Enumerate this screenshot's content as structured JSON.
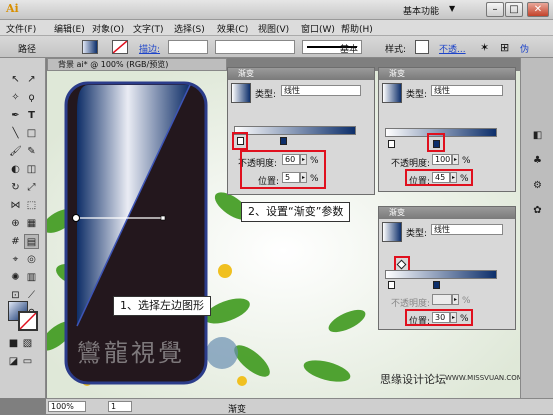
{
  "app": {
    "logo_text": "Ai",
    "workspace": "基本功能",
    "win_min": "–",
    "win_max": "□",
    "win_close": "✕"
  },
  "menu": [
    "文件(F)",
    "编辑(E)",
    "对象(O)",
    "文字(T)",
    "选择(S)",
    "效果(C)",
    "视图(V)",
    "窗口(W)",
    "帮助(H)"
  ],
  "control": {
    "mode_label": "路径",
    "stroke_label": "描边:",
    "stroke_style": "基本",
    "style_label": "样式:",
    "opacity_label": "不透...",
    "right_label": "伪"
  },
  "doc_tab": "背景 ai* @ 100% (RGB/预览)",
  "canvas": {
    "watermark": "鸞龍視覺",
    "forum_text": "思缘设计论坛",
    "forum_url": "WWW.MISSVUAN.COM"
  },
  "callouts": {
    "step1": "1、选择左边图形",
    "step2": "2、设置“渐变”参数"
  },
  "panel1": {
    "title": "渐变",
    "type_label": "类型:",
    "type_value": "线性",
    "opacity_label": "不透明度:",
    "opacity_value": "60",
    "position_label": "位置:",
    "position_value": "5",
    "unit": "%"
  },
  "panel2": {
    "title": "渐变",
    "type_label": "类型:",
    "type_value": "线性",
    "opacity_label": "不透明度:",
    "opacity_value": "100",
    "position_label": "位置:",
    "position_value": "45",
    "unit": "%"
  },
  "panel3": {
    "title": "渐变",
    "type_label": "类型:",
    "type_value": "线性",
    "opacity_label": "不透明度:",
    "opacity_value": "",
    "position_label": "位置:",
    "position_value": "30",
    "unit": "%"
  },
  "status": {
    "zoom": "100%",
    "page": "1",
    "panel_label": "渐变"
  }
}
